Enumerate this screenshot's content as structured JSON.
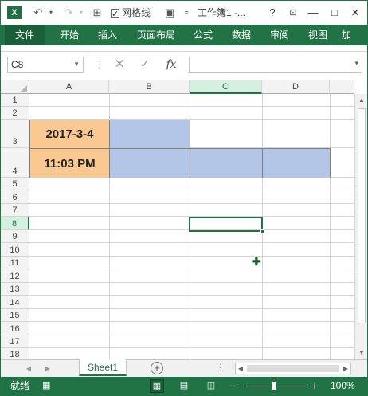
{
  "app": {
    "logo": "X",
    "title": "工作簿1 -..."
  },
  "qat": {
    "undo": "↶",
    "redo": "↷",
    "gridlines_label": "网格线"
  },
  "window_buttons": {
    "help": "?",
    "minimize": "—",
    "maximize": "□",
    "close": "✕"
  },
  "ribbon": {
    "tabs": [
      "文件",
      "开始",
      "插入",
      "页面布局",
      "公式",
      "数据",
      "审阅",
      "视图",
      "加"
    ]
  },
  "formula_bar": {
    "name_box": "C8",
    "fx": "fx",
    "formula": ""
  },
  "grid": {
    "columns": [
      "A",
      "B",
      "C",
      "D"
    ],
    "selected_column": "C",
    "rows": [
      "1",
      "2",
      "3",
      "4",
      "5",
      "6",
      "7",
      "8",
      "9",
      "10",
      "11",
      "12",
      "13",
      "14",
      "15",
      "16",
      "17",
      "18"
    ],
    "selected_row": "8",
    "cells": {
      "A3": "2017-3-4",
      "A4": "11:03 PM"
    },
    "active_cell": "C8"
  },
  "sheets": {
    "tabs": [
      "Sheet1"
    ],
    "add": "+"
  },
  "status": {
    "ready": "就绪",
    "zoom": "100%",
    "zoom_minus": "−",
    "zoom_plus": "+"
  },
  "colors": {
    "accent": "#217346",
    "orange_fill": "#fac891",
    "blue_fill": "#b4c6e7"
  }
}
